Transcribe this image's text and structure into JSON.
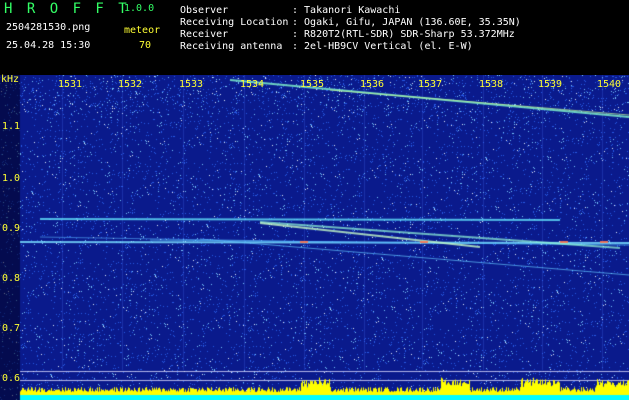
{
  "header": {
    "app_title": "H R O F F T",
    "version": "1.0.0",
    "filename": "2504281530.png",
    "datetime": "25.04.28 15:30",
    "mode_label": "meteor",
    "mode_value": "70",
    "info": [
      {
        "label": "Observer",
        "value": ": Takanori Kawachi"
      },
      {
        "label": "Receiving Location",
        "value": ": Ogaki, Gifu, JAPAN (136.60E, 35.35N)"
      },
      {
        "label": "Receiver",
        "value": ": R820T2(RTL-SDR) SDR-Sharp 53.372MHz"
      },
      {
        "label": "Receiving antenna",
        "value": ": 2el-HB9CV Vertical (el. E-W)"
      }
    ]
  },
  "axes": {
    "y_unit": "kHz",
    "y_ticks": [
      "1.1",
      "1.0",
      "0.9",
      "0.8",
      "0.7",
      "0.6"
    ],
    "x_ticks": [
      "1531",
      "1532",
      "1533",
      "1534",
      "1535",
      "1536",
      "1537",
      "1538",
      "1539",
      "1540"
    ]
  },
  "colors": {
    "background": "#000000",
    "spectrum_base": "#0a1a8c",
    "text_white": "#ffffff",
    "text_yellow": "#ffff33",
    "text_green": "#33ff66",
    "meter_bar": "#ffff00",
    "meter_base": "#00ffff"
  }
}
